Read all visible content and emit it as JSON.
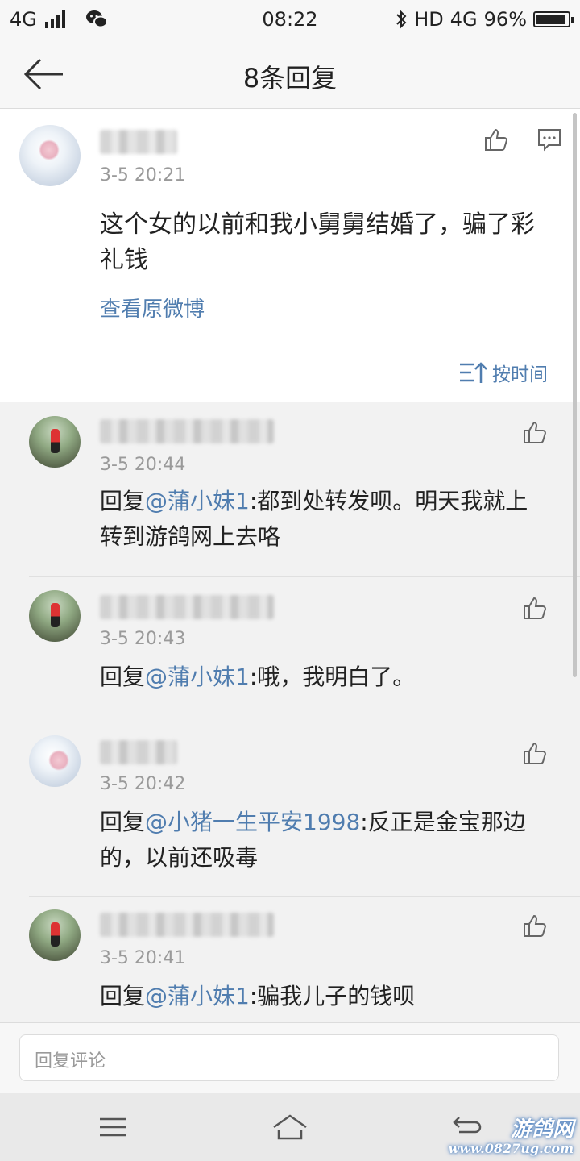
{
  "status_bar": {
    "network": "4G",
    "time": "08:22",
    "hd": "HD",
    "network_right": "4G",
    "battery_percent": "96%",
    "battery_level": 0.96
  },
  "nav": {
    "title": "8条回复"
  },
  "main_comment": {
    "time": "3-5 20:21",
    "text": "这个女的以前和我小舅舅结婚了，骗了彩礼钱",
    "view_original": "查看原微博",
    "sort_label": "按时间"
  },
  "replies": [
    {
      "time": "3-5 20:44",
      "prefix": "回复",
      "mention": "@蒲小妹1",
      "text": ":都到处转发呗。明天我就上转到游鸽网上去咯"
    },
    {
      "time": "3-5 20:43",
      "prefix": "回复",
      "mention": "@蒲小妹1",
      "text": ":哦，我明白了。"
    },
    {
      "time": "3-5 20:42",
      "prefix": "回复",
      "mention": "@小猪一生平安1998",
      "text": ":反正是金宝那边的，以前还吸毒"
    },
    {
      "time": "3-5 20:41",
      "prefix": "回复",
      "mention": "@蒲小妹1",
      "text": ":骗我儿子的钱呗"
    }
  ],
  "reply_input": {
    "placeholder": "回复评论"
  },
  "watermark": {
    "top": "游鸽网",
    "bottom": "www.0827ug.com"
  },
  "colors": {
    "link": "#507daf",
    "secondary_text": "#9a9a9a",
    "background": "#f2f2f2"
  }
}
